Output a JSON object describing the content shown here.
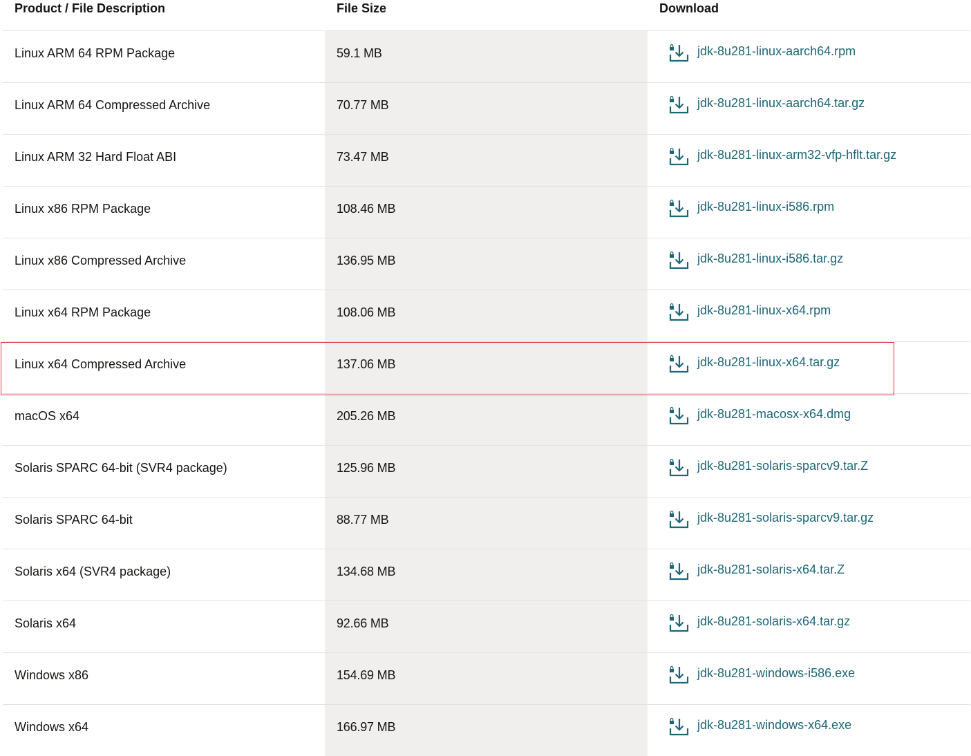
{
  "table": {
    "headers": {
      "description": "Product / File Description",
      "size": "File Size",
      "download": "Download"
    },
    "rows": [
      {
        "description": "Linux ARM 64 RPM Package",
        "size": "59.1 MB",
        "file": "jdk-8u281-linux-aarch64.rpm"
      },
      {
        "description": "Linux ARM 64 Compressed Archive",
        "size": "70.77 MB",
        "file": "jdk-8u281-linux-aarch64.tar.gz"
      },
      {
        "description": "Linux ARM 32 Hard Float ABI",
        "size": "73.47 MB",
        "file": "jdk-8u281-linux-arm32-vfp-hflt.tar.gz"
      },
      {
        "description": "Linux x86 RPM Package",
        "size": "108.46 MB",
        "file": "jdk-8u281-linux-i586.rpm"
      },
      {
        "description": "Linux x86 Compressed Archive",
        "size": "136.95 MB",
        "file": "jdk-8u281-linux-i586.tar.gz"
      },
      {
        "description": "Linux x64 RPM Package",
        "size": "108.06 MB",
        "file": "jdk-8u281-linux-x64.rpm"
      },
      {
        "description": "Linux x64 Compressed Archive",
        "size": "137.06 MB",
        "file": "jdk-8u281-linux-x64.tar.gz",
        "highlighted": true
      },
      {
        "description": "macOS x64",
        "size": "205.26 MB",
        "file": "jdk-8u281-macosx-x64.dmg"
      },
      {
        "description": "Solaris SPARC 64-bit (SVR4 package)",
        "size": "125.96 MB",
        "file": "jdk-8u281-solaris-sparcv9.tar.Z"
      },
      {
        "description": "Solaris SPARC 64-bit",
        "size": "88.77 MB",
        "file": "jdk-8u281-solaris-sparcv9.tar.gz"
      },
      {
        "description": "Solaris x64 (SVR4 package)",
        "size": "134.68 MB",
        "file": "jdk-8u281-solaris-x64.tar.Z"
      },
      {
        "description": "Solaris x64",
        "size": "92.66 MB",
        "file": "jdk-8u281-solaris-x64.tar.gz"
      },
      {
        "description": "Windows x86",
        "size": "154.69 MB",
        "file": "jdk-8u281-windows-i586.exe"
      },
      {
        "description": "Windows x64",
        "size": "166.97 MB",
        "file": "jdk-8u281-windows-x64.exe"
      }
    ]
  },
  "icons": {
    "download": "lock-download-icon"
  },
  "colors": {
    "link": "#1c6677",
    "shade": "#f1efed",
    "highlight": "#d9363e",
    "divider": "#e4e2e0"
  }
}
